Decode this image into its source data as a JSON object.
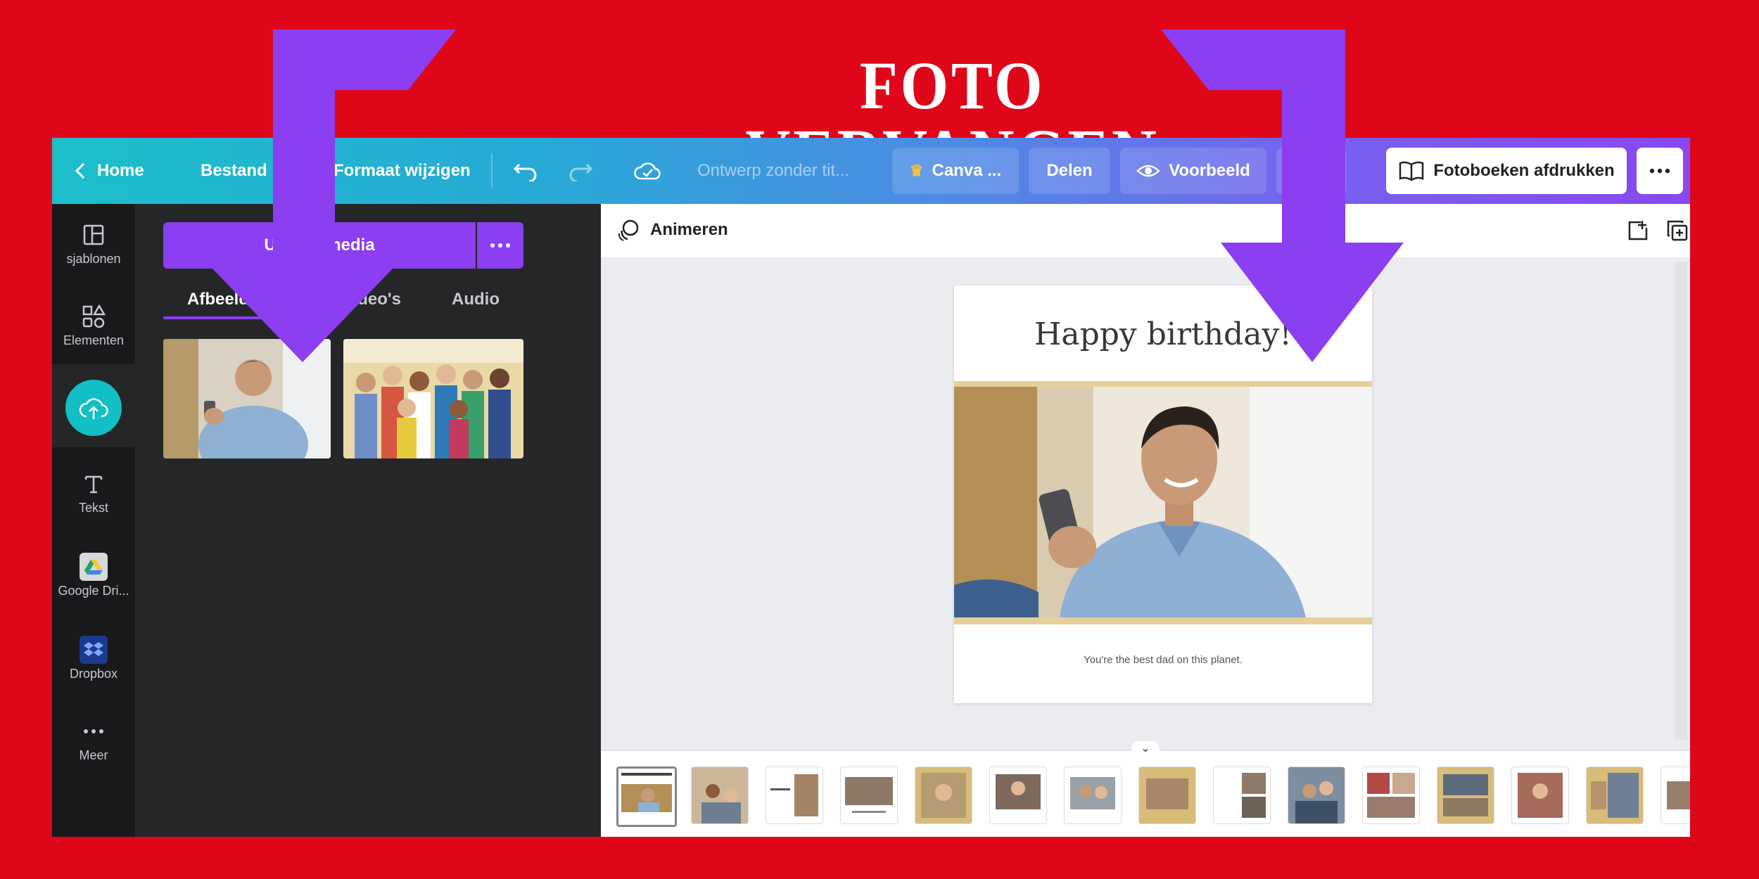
{
  "headline": "FOTO VERVANGEN",
  "topbar": {
    "home": "Home",
    "file": "Bestand",
    "resize": "Formaat wijzigen",
    "doc_title": "Ontwerp zonder tit...",
    "canva_pro": "Canva ...",
    "share": "Delen",
    "preview": "Voorbeeld",
    "print": "Fotoboeken afdrukken"
  },
  "rail": {
    "templates": "sjablonen",
    "elements": "Elementen",
    "text": "Tekst",
    "drive": "Google Dri...",
    "dropbox": "Dropbox",
    "more": "Meer"
  },
  "panel": {
    "upload_button": "Upload media",
    "tabs": [
      "Afbeeldingen",
      "Video's",
      "Audio"
    ]
  },
  "canvas": {
    "animate": "Animeren",
    "page_title": "Happy birthday!",
    "caption": "You're the best dad on this planet."
  },
  "colors": {
    "background": "#e0061a",
    "accent_purple": "#8b3ff0",
    "upload_teal": "#12bfc4"
  }
}
